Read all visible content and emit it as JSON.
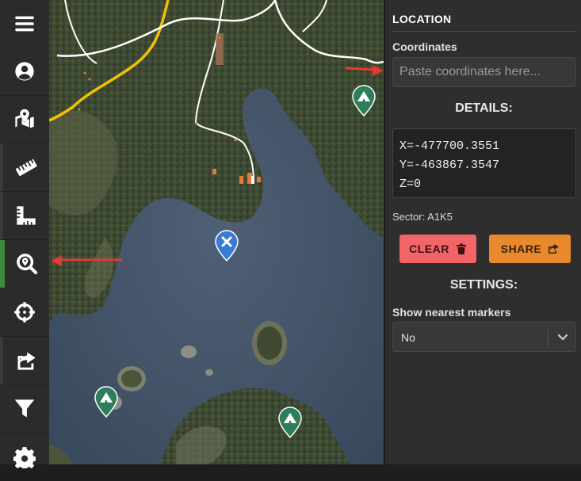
{
  "toolbar": {
    "items": [
      {
        "name": "menu",
        "icon": "hamburger-icon"
      },
      {
        "name": "account",
        "icon": "user-circle-icon"
      },
      {
        "name": "map",
        "icon": "map-marked-icon"
      },
      {
        "name": "ruler",
        "icon": "ruler-icon"
      },
      {
        "name": "ruler-combined",
        "icon": "ruler-combined-icon"
      },
      {
        "name": "location-search",
        "icon": "search-location-icon",
        "active": true
      },
      {
        "name": "crosshairs",
        "icon": "crosshairs-icon"
      },
      {
        "name": "share",
        "icon": "share-square-icon"
      },
      {
        "name": "filter",
        "icon": "filter-icon"
      },
      {
        "name": "settings",
        "icon": "cog-icon"
      }
    ]
  },
  "panel": {
    "header": "LOCATION",
    "coordinates_label": "Coordinates",
    "coordinates_placeholder": "Paste coordinates here...",
    "coordinates_value": "",
    "details_title": "DETAILS:",
    "details": {
      "x": "X=-477700.3551",
      "y": "Y=-463867.3547",
      "z": "Z=0"
    },
    "sector": "Sector: A1K5",
    "clear_label": "CLEAR",
    "share_label": "SHARE",
    "settings_title": "SETTINGS:",
    "nearest_markers_label": "Show nearest markers",
    "nearest_markers_value": "No"
  },
  "colors": {
    "active_accent": "#3d8b3d",
    "clear_button": "#f26466",
    "share_button": "#e8892e",
    "marker_blue": "#3a7bd5",
    "marker_green": "#2e7d5b",
    "road_yellow": "#f2c200",
    "annotation_arrow": "#e53935"
  }
}
